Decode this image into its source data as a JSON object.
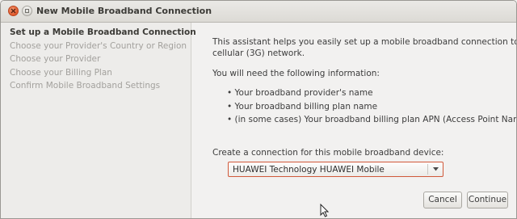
{
  "window": {
    "title": "New Mobile Broadband Connection"
  },
  "sidebar": {
    "steps": [
      {
        "label": "Set up a Mobile Broadband Connection",
        "active": true
      },
      {
        "label": "Choose your Provider's Country or Region",
        "active": false
      },
      {
        "label": "Choose your Provider",
        "active": false
      },
      {
        "label": "Choose your Billing Plan",
        "active": false
      },
      {
        "label": "Confirm Mobile Broadband Settings",
        "active": false
      }
    ]
  },
  "content": {
    "intro_line1": "This assistant helps you easily set up a mobile broadband connection to a",
    "intro_line2": "cellular (3G) network.",
    "need_info": "You will need the following information:",
    "bullets": [
      "• Your broadband provider's name",
      "• Your broadband billing plan name",
      "• (in some cases) Your broadband billing plan APN (Access Point Name)"
    ],
    "device_label": "Create a connection for this mobile broadband device:",
    "device_selected": "HUAWEI Technology HUAWEI Mobile"
  },
  "buttons": {
    "cancel": "Cancel",
    "continue": "Continue"
  },
  "icons": {
    "close": "close-icon",
    "minimize": "minimize-icon",
    "dropdown": "chevron-down-icon",
    "cursor": "mouse-pointer-icon"
  },
  "colors": {
    "close_button": "#e2572a",
    "combo_focus_border": "#d1593a",
    "sidebar_bg": "#edecea",
    "window_bg": "#f2f1f0"
  }
}
